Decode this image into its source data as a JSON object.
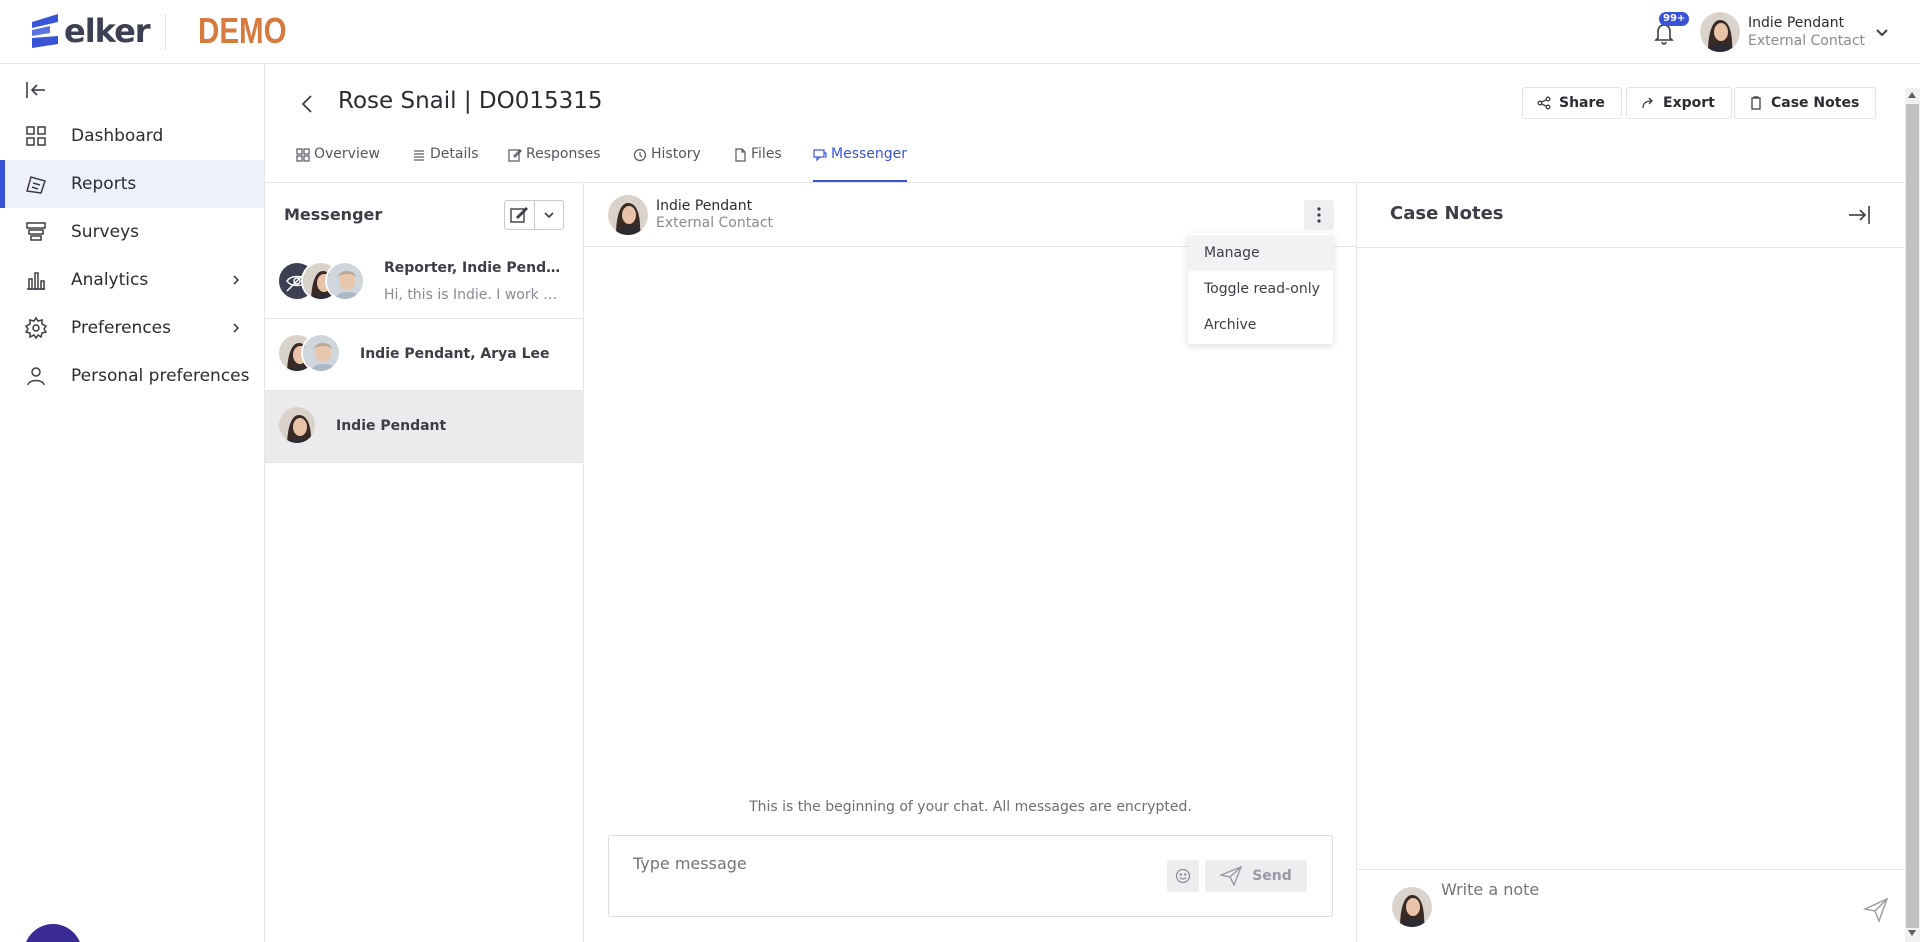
{
  "brand": {
    "logo_text": "elker",
    "demo_label": "DEMO"
  },
  "topbar": {
    "notification_badge": "99+",
    "user": {
      "name": "Indie Pendant",
      "role": "External Contact"
    }
  },
  "sidebar": {
    "items": [
      {
        "label": "Dashboard",
        "icon": "dashboard-icon",
        "active": false
      },
      {
        "label": "Reports",
        "icon": "reports-icon",
        "active": true
      },
      {
        "label": "Surveys",
        "icon": "surveys-icon",
        "active": false
      },
      {
        "label": "Analytics",
        "icon": "analytics-icon",
        "active": false,
        "has_submenu": true
      },
      {
        "label": "Preferences",
        "icon": "gear-icon",
        "active": false,
        "has_submenu": true
      },
      {
        "label": "Personal preferences",
        "icon": "user-icon",
        "active": false
      }
    ]
  },
  "case": {
    "title": "Rose Snail | DO015315",
    "actions": {
      "share": "Share",
      "export": "Export",
      "case_notes": "Case Notes"
    },
    "tabs": [
      {
        "label": "Overview",
        "icon": "grid-icon"
      },
      {
        "label": "Details",
        "icon": "list-icon"
      },
      {
        "label": "Responses",
        "icon": "edit-icon"
      },
      {
        "label": "History",
        "icon": "history-icon"
      },
      {
        "label": "Files",
        "icon": "file-icon"
      },
      {
        "label": "Messenger",
        "icon": "chat-icon",
        "active": true
      }
    ]
  },
  "messenger": {
    "title": "Messenger",
    "conversations": [
      {
        "name": "Reporter, Indie Pendant, Arya Lee",
        "preview": "Hi, this is Indie. I work More..."
      },
      {
        "name": "Indie Pendant, Arya Lee",
        "preview": ""
      },
      {
        "name": "Indie Pendant",
        "preview": "",
        "selected": true
      }
    ]
  },
  "chat": {
    "participant": {
      "name": "Indie Pendant",
      "role": "External Contact"
    },
    "menu": [
      "Manage",
      "Toggle read-only",
      "Archive"
    ],
    "beginning_note": "This is the beginning of your chat. All messages are encrypted.",
    "input_placeholder": "Type message",
    "send_label": "Send"
  },
  "notes": {
    "title": "Case Notes",
    "input_placeholder": "Write a note"
  },
  "colors": {
    "accent": "#3954d6",
    "demo": "#d77a3d",
    "record_bg": "#3a2a93",
    "record_dot": "#f04060"
  }
}
